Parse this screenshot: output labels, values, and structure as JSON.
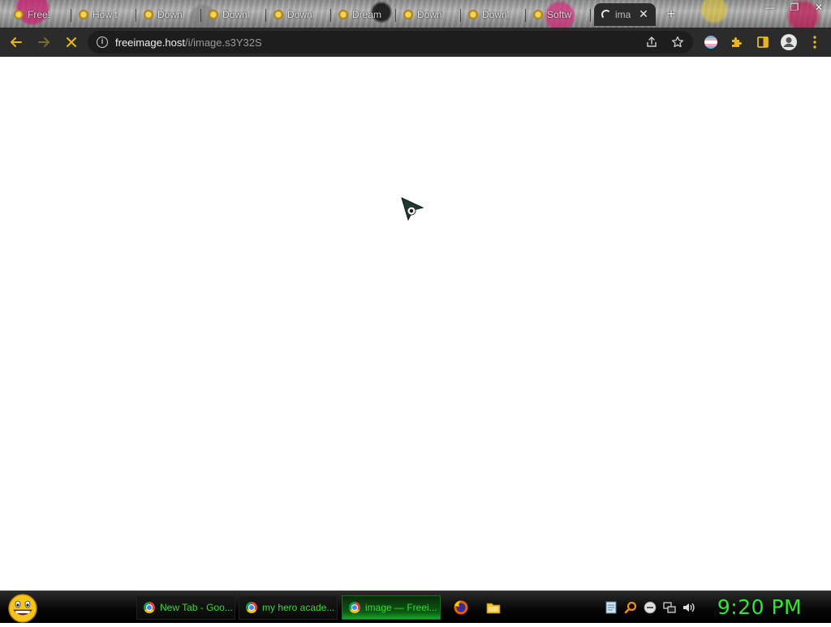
{
  "browser": {
    "tabs": [
      {
        "label": "Free!"
      },
      {
        "label": "How t"
      },
      {
        "label": "Downl"
      },
      {
        "label": "Downl"
      },
      {
        "label": "Downl"
      },
      {
        "label": "Dream"
      },
      {
        "label": "Downl"
      },
      {
        "label": "Downl"
      },
      {
        "label": "Softw"
      }
    ],
    "active_tab": {
      "label": "ima",
      "close_glyph": "✕"
    },
    "new_tab_glyph": "+",
    "window_controls": {
      "minimize": "—",
      "restore": "❐",
      "close": "✕"
    }
  },
  "toolbar": {
    "url_host": "freeimage.host",
    "url_path": "/i/image.s3Y32S"
  },
  "taskbar": {
    "tasks": [
      {
        "label": "New Tab - Goo..."
      },
      {
        "label": "my hero acade..."
      },
      {
        "label": "image — Freei..."
      }
    ],
    "clock": "9:20 PM"
  },
  "colors": {
    "toolbar_bg": "#2b2b2b",
    "omnibox_bg": "#1d1d1d",
    "taskbar_text": "#33dd33",
    "clock_text": "#2ee82e",
    "extension_accent": "#e8b61c"
  }
}
